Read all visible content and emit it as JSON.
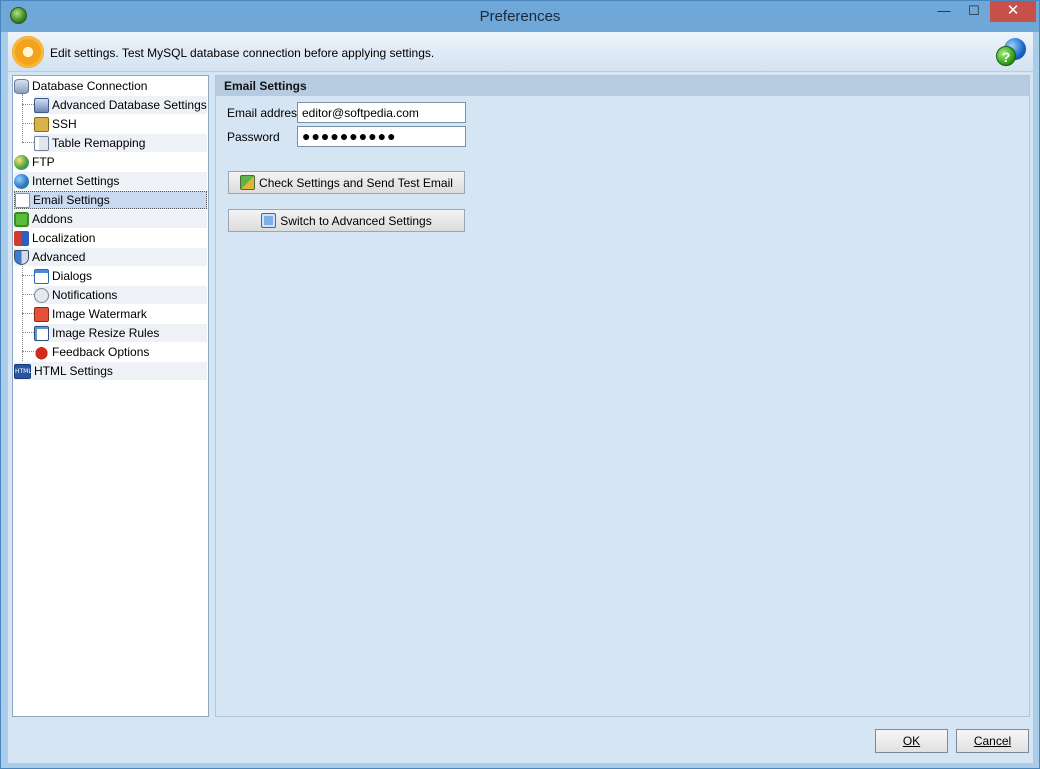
{
  "window": {
    "title": "Preferences",
    "minimize_glyph": "—",
    "maximize_glyph": "☐",
    "close_glyph": "✕"
  },
  "header": {
    "text": "Edit settings. Test MySQL database connection before applying settings.",
    "help_glyph": "?"
  },
  "tree": {
    "items": [
      {
        "label": "Database Connection",
        "icon": "database-icon",
        "level": 0
      },
      {
        "label": "Advanced Database Settings",
        "icon": "database-settings-icon",
        "level": 1
      },
      {
        "label": "SSH",
        "icon": "lock-icon",
        "level": 1
      },
      {
        "label": "Table Remapping",
        "icon": "table-icon",
        "level": 1
      },
      {
        "label": "FTP",
        "icon": "ftp-icon",
        "level": 0
      },
      {
        "label": "Internet Settings",
        "icon": "globe-icon",
        "level": 0
      },
      {
        "label": "Email Settings",
        "icon": "mail-icon",
        "level": 0,
        "selected": true
      },
      {
        "label": "Addons",
        "icon": "puzzle-icon",
        "level": 0
      },
      {
        "label": "Localization",
        "icon": "flag-icon",
        "level": 0
      },
      {
        "label": "Advanced",
        "icon": "shield-icon",
        "level": 0
      },
      {
        "label": "Dialogs",
        "icon": "dialog-icon",
        "level": 1
      },
      {
        "label": "Notifications",
        "icon": "notification-icon",
        "level": 1
      },
      {
        "label": "Image Watermark",
        "icon": "watermark-icon",
        "level": 1
      },
      {
        "label": "Image Resize Rules",
        "icon": "resize-icon",
        "level": 1
      },
      {
        "label": "Feedback Options",
        "icon": "bug-icon",
        "level": 1
      },
      {
        "label": "HTML Settings",
        "icon": "html-icon",
        "level": 0
      }
    ]
  },
  "panel": {
    "title": "Email Settings",
    "email_label": "Email address",
    "email_value": "editor@softpedia.com",
    "password_label": "Password",
    "password_value": "●●●●●●●●●●",
    "check_button": "Check Settings and Send Test Email",
    "advanced_button": "Switch to Advanced Settings"
  },
  "footer": {
    "ok_label": "OK",
    "cancel_label": "Cancel"
  },
  "html_icon_text": "HTML"
}
